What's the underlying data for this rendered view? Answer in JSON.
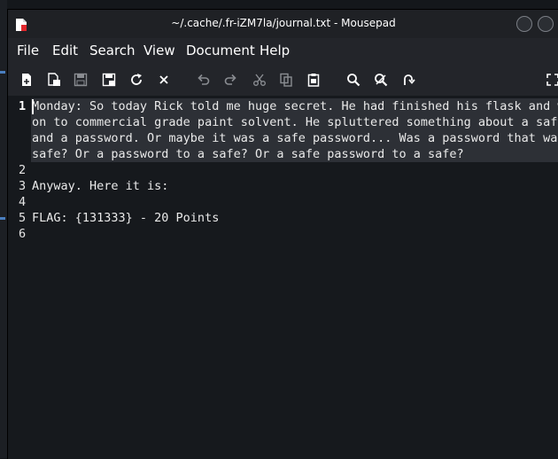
{
  "window": {
    "title": "~/.cache/.fr-iZM7la/journal.txt - Mousepad"
  },
  "menu": [
    "File",
    "Edit",
    "Search",
    "View",
    "Document",
    "Help"
  ],
  "toolbar": {
    "buttons": [
      "new",
      "new-window",
      "save",
      "save-as",
      "reload",
      "close",
      "undo",
      "redo",
      "cut",
      "copy",
      "paste",
      "find",
      "find-replace",
      "go-to-line",
      "fullscreen"
    ]
  },
  "editor": {
    "line_numbers": [
      "1",
      "2",
      "3",
      "4",
      "5",
      "6"
    ],
    "visual_lines": [
      "Monday: So today Rick told me huge secret. He had finished his flask and wa",
      "on to commercial grade paint solvent. He spluttered something about a safe",
      "and a password. Or maybe it was a safe password... Was a password that was",
      "safe? Or a password to a safe? Or a safe password to a safe?",
      "",
      "Anyway. Here it is:",
      "",
      "FLAG: {131333} - 20 Points",
      ""
    ]
  },
  "colors": {
    "background": "#16191d",
    "current_line": "#2d3036",
    "text": "#eaeaea",
    "chrome": "#23252a"
  }
}
